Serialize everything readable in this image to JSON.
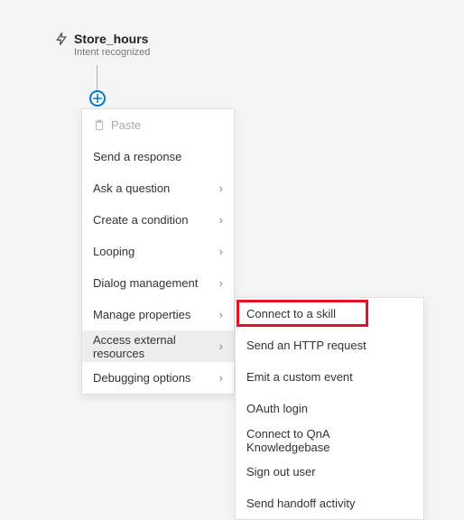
{
  "trigger": {
    "title": "Store_hours",
    "subtitle": "Intent recognized"
  },
  "primary_menu": {
    "paste_label": "Paste",
    "items": [
      {
        "label": "Send a response",
        "submenu": false
      },
      {
        "label": "Ask a question",
        "submenu": true
      },
      {
        "label": "Create a condition",
        "submenu": true
      },
      {
        "label": "Looping",
        "submenu": true
      },
      {
        "label": "Dialog management",
        "submenu": true
      },
      {
        "label": "Manage properties",
        "submenu": true
      },
      {
        "label": "Access external resources",
        "submenu": true,
        "hover": true
      },
      {
        "label": "Debugging options",
        "submenu": true
      }
    ]
  },
  "secondary_menu": {
    "items": [
      {
        "label": "Connect to a skill",
        "highlight": true
      },
      {
        "label": "Send an HTTP request"
      },
      {
        "label": "Emit a custom event"
      },
      {
        "label": "OAuth login"
      },
      {
        "label": "Connect to QnA Knowledgebase"
      },
      {
        "label": "Sign out user"
      },
      {
        "label": "Send handoff activity"
      }
    ]
  }
}
